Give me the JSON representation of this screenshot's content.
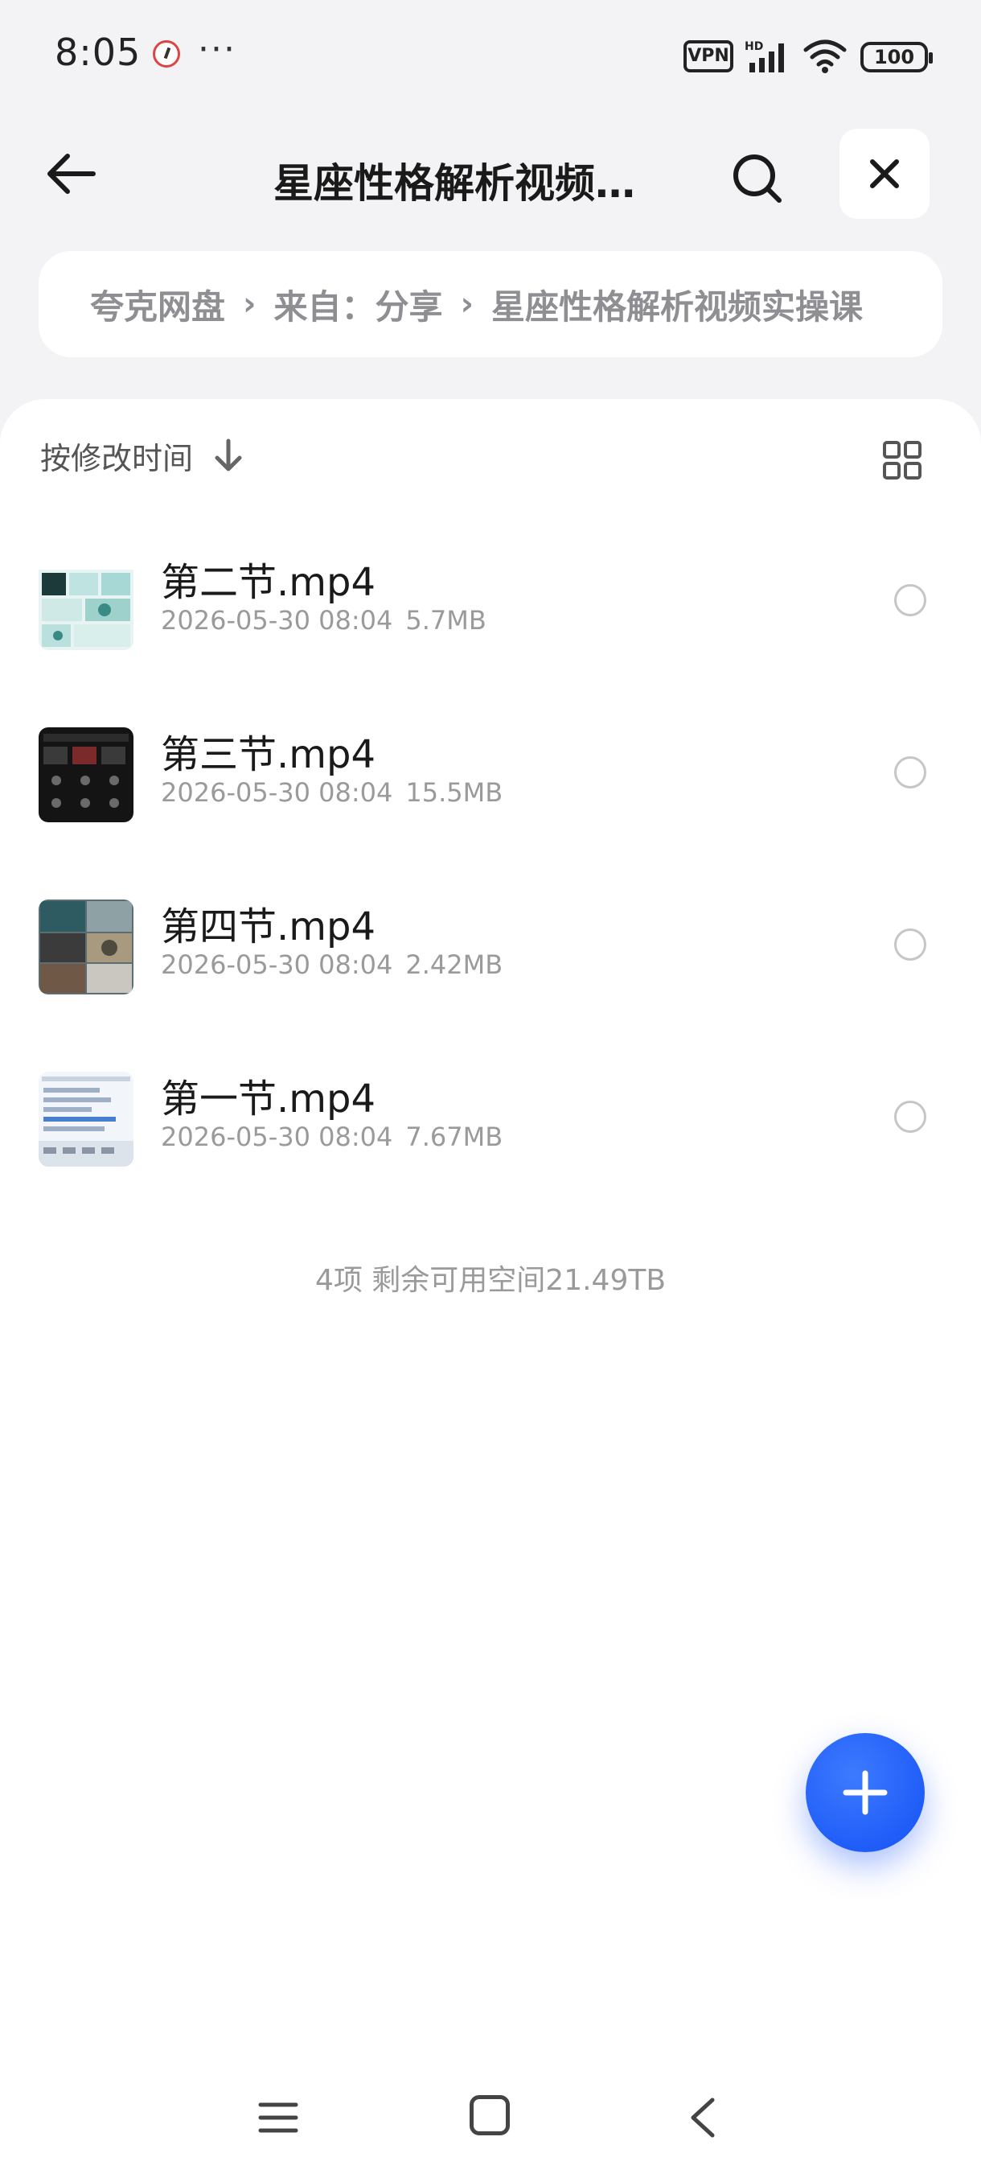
{
  "status_bar": {
    "time": "8:05",
    "more": "···",
    "vpn": "VPN",
    "battery": "100",
    "icons": [
      "app-notification-icon",
      "vpn-icon",
      "hd-signal-icon",
      "wifi-icon",
      "battery-icon"
    ]
  },
  "header": {
    "title": "星座性格解析视频实操课",
    "icons": [
      "back-arrow-icon",
      "search-icon",
      "close-icon"
    ]
  },
  "breadcrumb": {
    "items": [
      "夸克网盘",
      "来自：分享",
      "星座性格解析视频实操课"
    ],
    "separator": "›"
  },
  "sort": {
    "label": "按修改时间",
    "icons": [
      "sort-down-arrow-icon",
      "grid-view-icon"
    ]
  },
  "files": [
    {
      "name": "第二节.mp4",
      "date": "2026-05-30 08:04",
      "size": "5.7MB"
    },
    {
      "name": "第三节.mp4",
      "date": "2026-05-30 08:04",
      "size": "15.5MB"
    },
    {
      "name": "第四节.mp4",
      "date": "2026-05-30 08:04",
      "size": "2.42MB"
    },
    {
      "name": "第一节.mp4",
      "date": "2026-05-30 08:04",
      "size": "7.67MB"
    }
  ],
  "summary": "4项 剩余可用空间21.49TB",
  "colors": {
    "accent": "#1450f5",
    "background": "#f3f3f5",
    "muted": "#9a9a9a"
  },
  "nav_icons": [
    "menu-icon",
    "home-icon",
    "nav-back-icon"
  ]
}
